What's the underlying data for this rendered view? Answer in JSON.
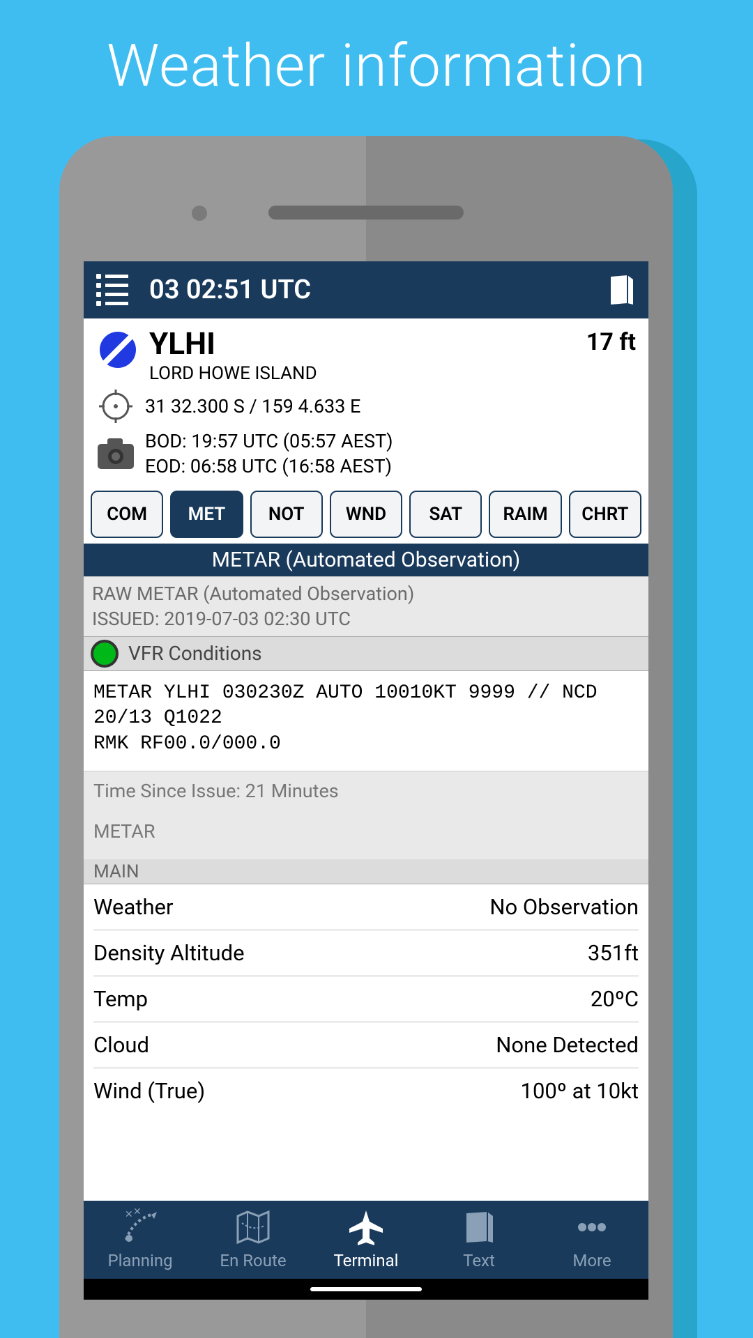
{
  "promo": {
    "title": "Weather information"
  },
  "header": {
    "time": "03 02:51 UTC"
  },
  "airport": {
    "code": "YLHI",
    "name": "LORD HOWE ISLAND",
    "elevation": "17 ft",
    "coords": "31 32.300 S / 159 4.633 E",
    "bod": "BOD: 19:57 UTC (05:57 AEST)",
    "eod": "EOD: 06:58 UTC (16:58 AEST)"
  },
  "tabs": {
    "items": [
      "COM",
      "MET",
      "NOT",
      "WND",
      "SAT",
      "RAIM",
      "CHRT"
    ],
    "activeIndex": 1
  },
  "metar": {
    "section_title": "METAR (Automated Observation)",
    "raw_label": "RAW METAR (Automated Observation)",
    "issued": "ISSUED: 2019-07-03 02:30 UTC",
    "status_text": "VFR Conditions",
    "status_color": "#00b818",
    "raw": "METAR YLHI 030230Z AUTO 10010KT 9999 // NCD 20/13 Q1022\nRMK RF00.0/000.0",
    "time_since": "Time Since Issue: 21 Minutes",
    "sub_label": "METAR",
    "main_label": "MAIN",
    "rows": [
      {
        "label": "Weather",
        "value": "No Observation"
      },
      {
        "label": "Density Altitude",
        "value": "351ft"
      },
      {
        "label": "Temp",
        "value": "20ºC"
      },
      {
        "label": "Cloud",
        "value": "None Detected"
      },
      {
        "label": "Wind (True)",
        "value": "100º at 10kt"
      }
    ]
  },
  "nav": {
    "items": [
      "Planning",
      "En Route",
      "Terminal",
      "Text",
      "More"
    ],
    "activeIndex": 2
  }
}
